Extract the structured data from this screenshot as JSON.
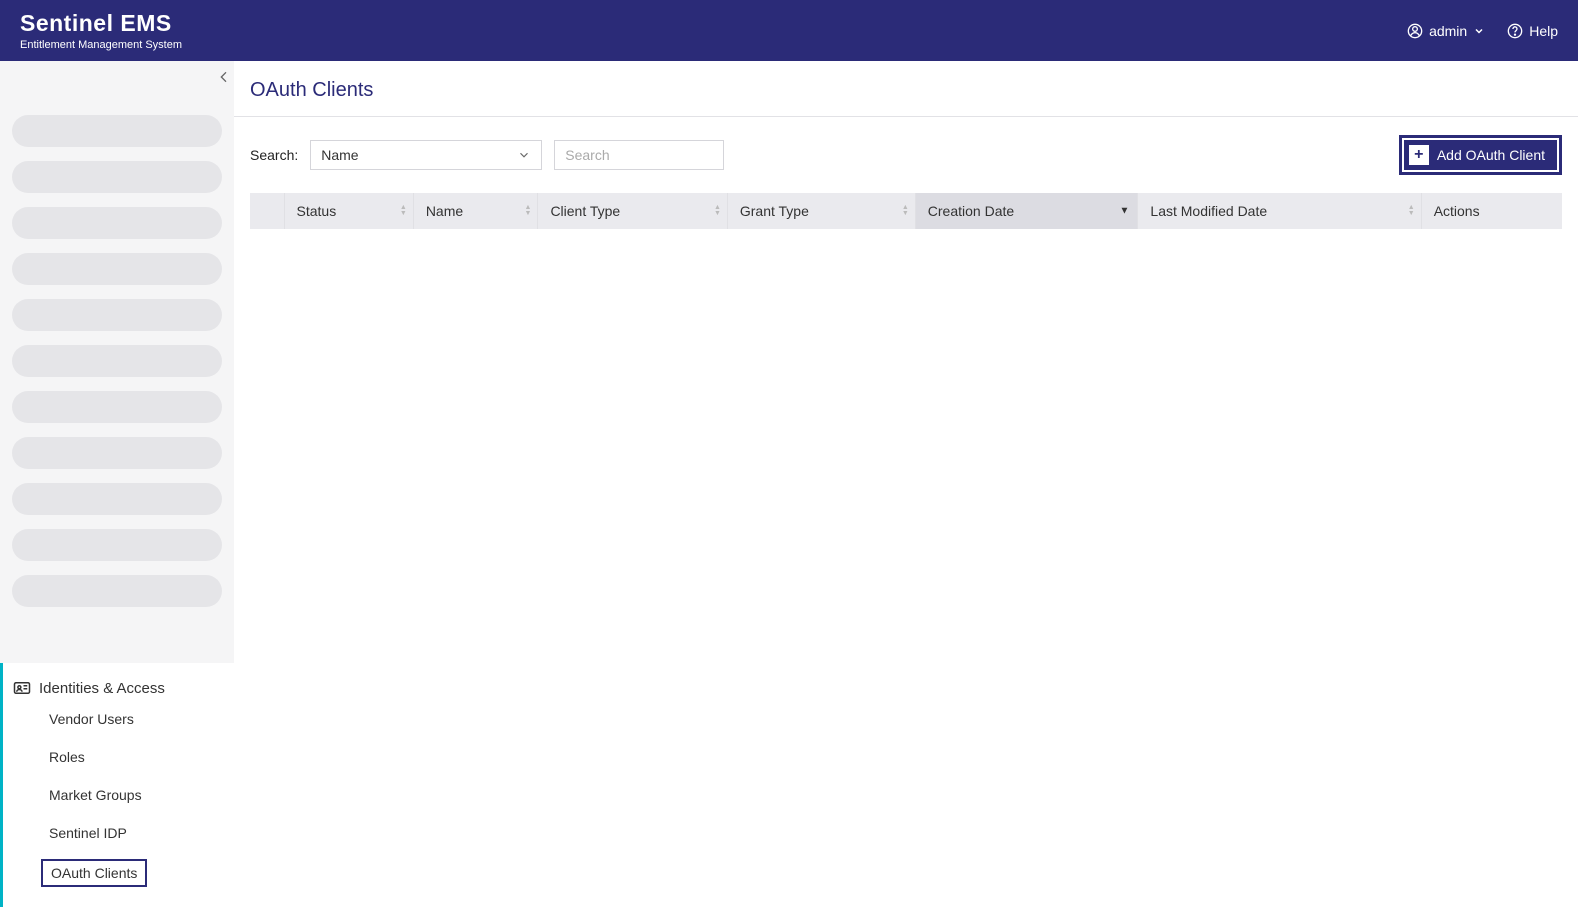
{
  "header": {
    "brand_title": "Sentinel EMS",
    "brand_subtitle": "Entitlement Management System",
    "user_label": "admin",
    "help_label": "Help"
  },
  "sidebar": {
    "section_title": "Identities & Access",
    "items": [
      {
        "label": "Vendor Users",
        "active": false
      },
      {
        "label": "Roles",
        "active": false
      },
      {
        "label": "Market Groups",
        "active": false
      },
      {
        "label": "Sentinel IDP",
        "active": false
      },
      {
        "label": "OAuth Clients",
        "active": true
      }
    ]
  },
  "main": {
    "page_title": "OAuth Clients",
    "search_label": "Search:",
    "search_select_value": "Name",
    "search_placeholder": "Search",
    "add_button_label": "Add OAuth Client",
    "columns": [
      {
        "label": "Status"
      },
      {
        "label": "Name"
      },
      {
        "label": "Client Type"
      },
      {
        "label": "Grant Type"
      },
      {
        "label": "Creation Date",
        "sorted": "desc"
      },
      {
        "label": "Last Modified Date"
      },
      {
        "label": "Actions"
      }
    ],
    "rows": []
  }
}
